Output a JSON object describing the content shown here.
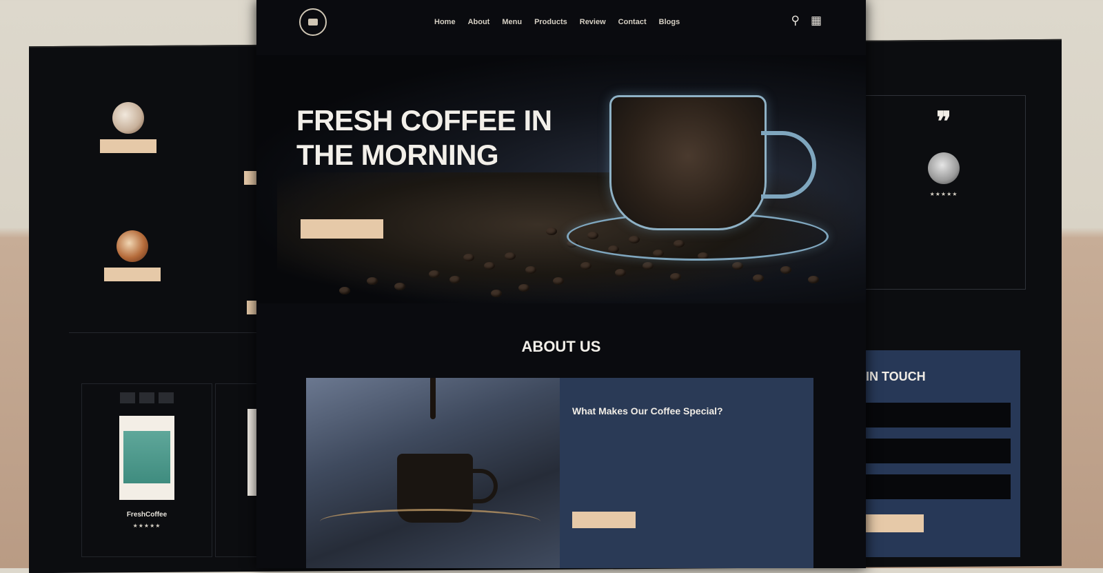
{
  "nav": {
    "items": [
      "Home",
      "About",
      "Menu",
      "Products",
      "Review",
      "Contact",
      "Blogs"
    ],
    "icons": [
      "search-icon",
      "cart-icon"
    ]
  },
  "hero": {
    "title": "FRESH COFFEE IN THE MORNING",
    "text": "",
    "button_label": ""
  },
  "about": {
    "title": "ABOUT US",
    "subtitle": "What Makes Our Coffee Special?",
    "paragraph1": "",
    "paragraph2": "",
    "button_label": ""
  },
  "menu_section": {
    "items": [
      {
        "name": "",
        "price": "",
        "button_label": ""
      },
      {
        "name": "",
        "price": "",
        "button_label": ""
      }
    ]
  },
  "products_section": {
    "tabs": [
      "",
      "",
      ""
    ],
    "product": {
      "name": "FreshCoffee",
      "rating": "★★★★★",
      "price": ""
    }
  },
  "review": {
    "text": "",
    "name": "",
    "rating": "★★★★★"
  },
  "contact": {
    "title": "IN TOUCH",
    "fields": [
      "",
      "",
      ""
    ],
    "button_label": ""
  },
  "colors": {
    "accent": "#e6c9a8",
    "background": "#0a0b0f",
    "panel": "#2a3a56"
  }
}
